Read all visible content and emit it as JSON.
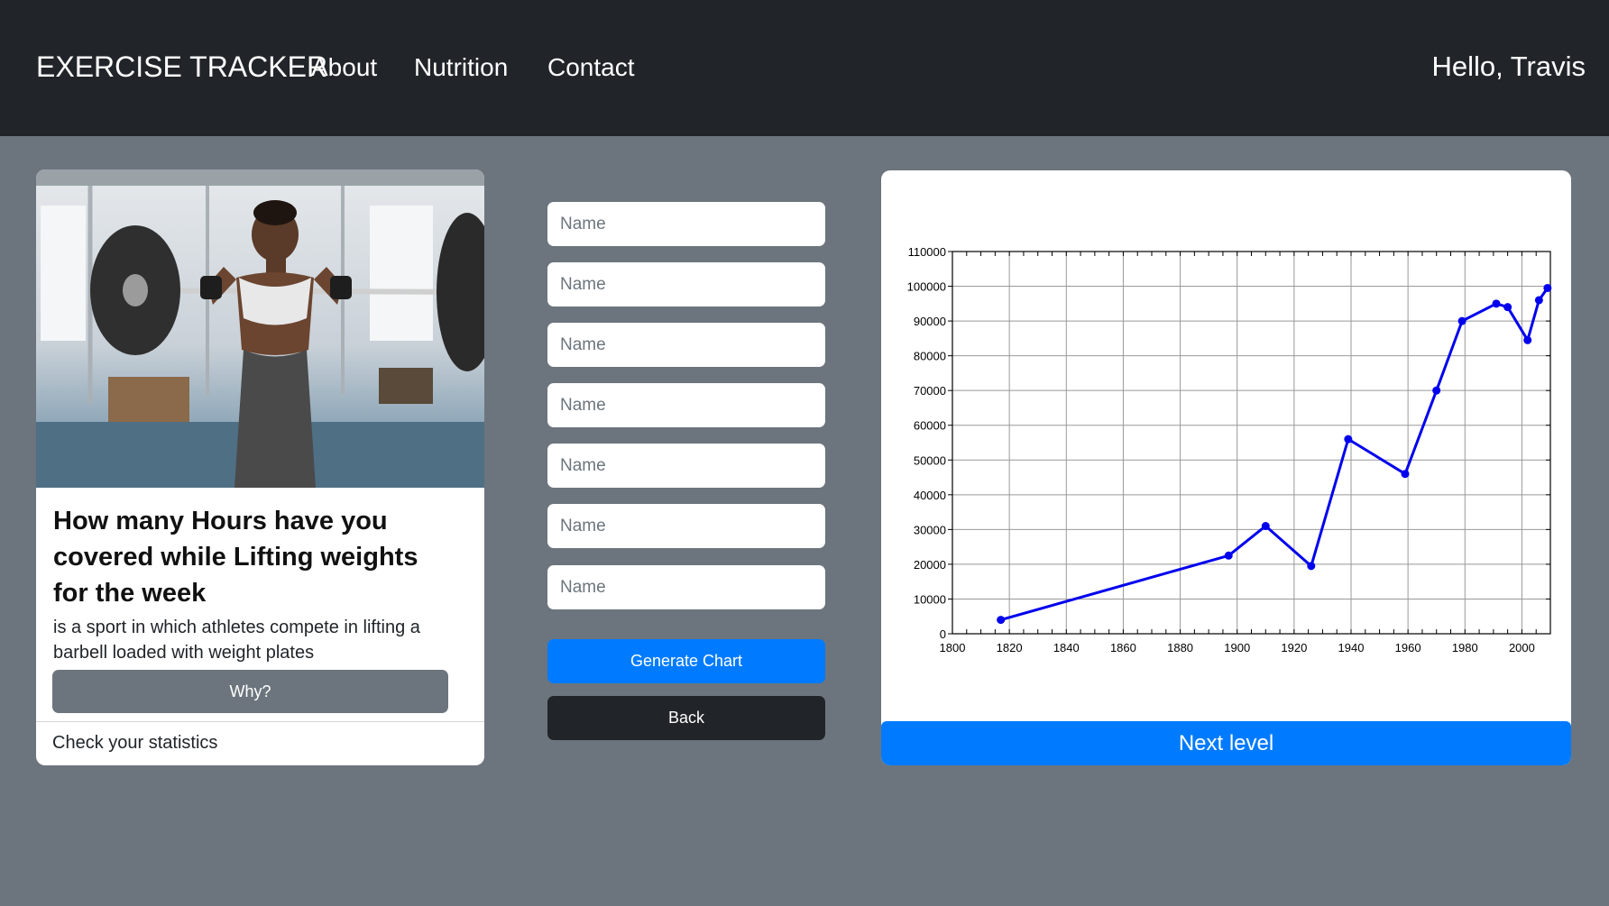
{
  "navbar": {
    "brand": "EXERCISE TRACKER",
    "links": [
      "About",
      "Nutrition",
      "Contact"
    ],
    "greeting": "Hello, Travis"
  },
  "card": {
    "image_alt": "Woman lifting a barbell in a gym",
    "title": "How many Hours have you covered while Lifting weights for the week",
    "text": "is a sport in which athletes compete in lifting a barbell loaded with weight plates",
    "button": "Why?",
    "footer": "Check your statistics"
  },
  "form": {
    "placeholders": [
      "Name",
      "Name",
      "Name",
      "Name",
      "Name",
      "Name",
      "Name"
    ],
    "generate_label": "Generate Chart",
    "back_label": "Back"
  },
  "next_label": "Next level",
  "colors": {
    "line": "#0000ee",
    "primary": "#007bff",
    "dark": "#212529",
    "secondary": "#6c757d"
  },
  "chart_data": {
    "type": "line",
    "title": "",
    "xlabel": "",
    "ylabel": "",
    "xlim": [
      1800,
      2010
    ],
    "ylim": [
      0,
      110000
    ],
    "grid": true,
    "x_ticks": [
      1800,
      1820,
      1840,
      1860,
      1880,
      1900,
      1920,
      1940,
      1960,
      1980,
      2000
    ],
    "y_ticks": [
      0,
      10000,
      20000,
      30000,
      40000,
      50000,
      60000,
      70000,
      80000,
      90000,
      100000,
      110000
    ],
    "series": [
      {
        "x": [
          1817,
          1897,
          1910,
          1926,
          1939,
          1959,
          1970,
          1979,
          1991,
          1995,
          2002,
          2006,
          2009
        ],
        "y": [
          4000,
          22500,
          31000,
          19500,
          56000,
          46000,
          70000,
          90000,
          95000,
          94000,
          84500,
          96000,
          99500
        ]
      }
    ]
  }
}
